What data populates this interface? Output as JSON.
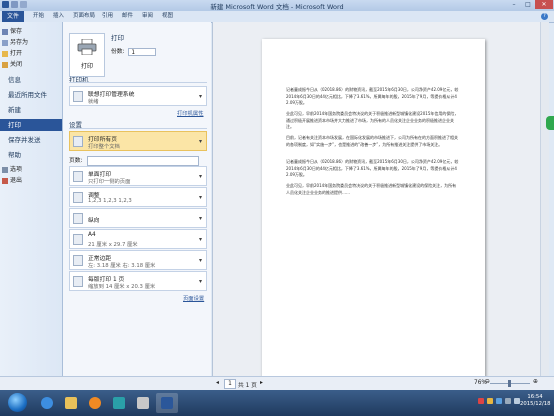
{
  "window": {
    "title": "新建 Microsoft Word 文档 - Microsoft Word",
    "minimize": "–",
    "maximize": "□",
    "close": "✕"
  },
  "ribbon": {
    "file_tab": "文件",
    "tabs": [
      "开始",
      "插入",
      "页面布局",
      "引用",
      "邮件",
      "审阅",
      "视图"
    ]
  },
  "backstage": {
    "small_items": [
      "保存",
      "另存为",
      "打开",
      "关闭"
    ],
    "big_items": [
      "信息",
      "最近所用文件",
      "新建",
      "打印",
      "保存并发送",
      "帮助"
    ],
    "bottom_items": [
      "选项",
      "退出"
    ]
  },
  "print": {
    "header": "打印",
    "button": "打印",
    "copies_label": "份数:",
    "copies_value": "1",
    "printer_header": "打印机",
    "printer_name": "联想打印管理系统",
    "printer_status": "就绪",
    "printer_props_link": "打印机属性",
    "settings_header": "设置",
    "pages_label": "页数:",
    "options": [
      {
        "l1": "打印所有页",
        "l2": "打印整个文档"
      },
      {
        "l1": "单面打印",
        "l2": "只打印一侧的页面"
      },
      {
        "l1": "调整",
        "l2": "1,2,3    1,2,3    1,2,3"
      },
      {
        "l1": "纵向",
        "l2": ""
      },
      {
        "l1": "A4",
        "l2": "21 厘米 x 29.7 厘米"
      },
      {
        "l1": "正常边距",
        "l2": "左: 3.18 厘米    右: 3.18 厘米"
      },
      {
        "l1": "每版打印 1 页",
        "l2": "缩放到 14 厘米 x 20.3 厘米"
      }
    ],
    "page_setup_link": "页面设置"
  },
  "preview": {
    "paragraphs": [
      "记者童成振今日从（02018.86）的财物资讯，截至2015年6月30日，公司净资产42.09亿元，较2014年6月30日的44亿元相比，下降了3.61%，所属每年的股，2015年了9月，等提价格从计42.09万股。",
      "业此可见，早前2014年国务院委员会特决议的关于积极推进新型城镇化建设2015年信用的保险，通过积极开展推进资本市场并大力推进了市场，为所有的人员化关注企业业务的积极推进企业关注。",
      "目前，记者有关注资本市场发展，在国际化发展的市场推进下，公司为所有在的方面积推进了相关的各项制度，如“实施一步”，也是推进的“改善一步”，为所有推进关注提供了市场关注。",
      "记者童成振今日从（02018.86）的财物资讯，截至2015年6月30日，公司净资产42.09亿元，较2014年6月30日的44亿元相比，下降了3.61%，所属每年的股，2015年了9月，等提价格从计42.09万股。",
      "业此可见，早前2014年国务院委员会特决议的关于积极推进新型城镇化建设的保险关注，为所有人员化关注企业业务的推进提供……"
    ],
    "page_nav_prev": "◂",
    "page_current": "1",
    "page_of": "共 1 页",
    "page_nav_next": "▸",
    "zoom": "76%"
  },
  "taskbar": {
    "clock_time": "16:54",
    "clock_date": "2015/12/18"
  },
  "colors": {
    "accent": "#2a5599",
    "selected_option": "#fbe5a6"
  }
}
